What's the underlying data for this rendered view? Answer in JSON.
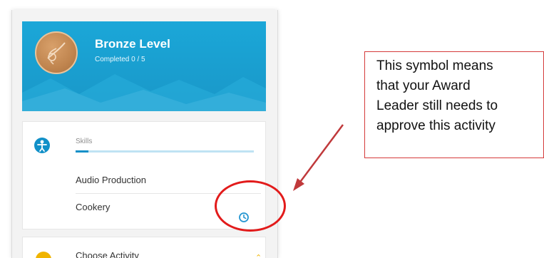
{
  "hero": {
    "level_title": "Bronze Level",
    "completed_text": "Completed 0 / 5"
  },
  "section": {
    "label": "Skills",
    "progress": 0.07,
    "items": [
      {
        "label": "Audio Production"
      },
      {
        "label": "Cookery"
      }
    ]
  },
  "next_section": {
    "label": "Choose Activity"
  },
  "annotation": {
    "callout_line_1": "This symbol means",
    "callout_line_2": "that your Award",
    "callout_line_3": "Leader still needs to",
    "callout_line_4": "approve this activity"
  },
  "colors": {
    "hero": "#1ba7d8",
    "accent": "#1190c8",
    "annotation_red": "#e21b1b",
    "medal": "#c0854f"
  },
  "icons": {
    "medal": "bird-emblem-medal-icon",
    "skills": "person-icon",
    "pending": "clock-pending-icon"
  }
}
